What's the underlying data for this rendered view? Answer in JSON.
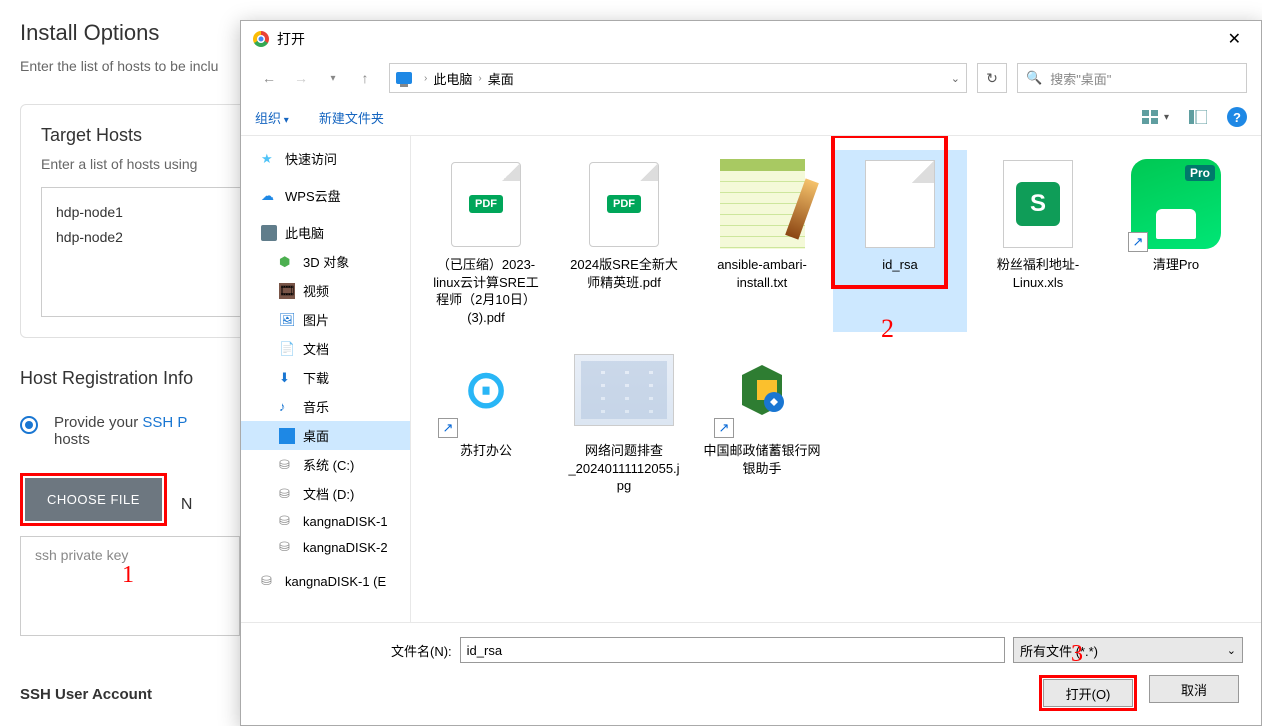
{
  "bg": {
    "title": "Install Options",
    "subtitle": "Enter the list of hosts to be inclu",
    "targetHosts": {
      "heading": "Target Hosts",
      "desc": "Enter a list of hosts using",
      "line1": "hdp-node1",
      "line2": "hdp-node2"
    },
    "reg": {
      "heading": "Host Registration Info",
      "radioLabel_pre": "Provide your ",
      "radioLabel_link": "SSH P",
      "radioLabel_post": "hosts",
      "chooseFile": "CHOOSE FILE",
      "letterN": "N",
      "keyPlaceholder": "ssh private key",
      "sshAccount": "SSH User Account"
    },
    "annotation1": "1"
  },
  "dialog": {
    "title": "打开",
    "path": {
      "seg1": "此电脑",
      "seg2": "桌面"
    },
    "searchPlaceholder": "搜索\"桌面\"",
    "toolbar": {
      "organize": "组织",
      "newFolder": "新建文件夹"
    },
    "sidebar": {
      "quickAccess": "快速访问",
      "wps": "WPS云盘",
      "thisPc": "此电脑",
      "d3": "3D 对象",
      "video": "视频",
      "pictures": "图片",
      "docs": "文档",
      "downloads": "下载",
      "music": "音乐",
      "desktop": "桌面",
      "sysC": "系统 (C:)",
      "docD": "文档 (D:)",
      "kd1": "kangnaDISK-1",
      "kd2": "kangnaDISK-2",
      "kd1e": "kangnaDISK-1 (E"
    },
    "files": {
      "f1": "（已压缩）2023-linux云计算SRE工程师（2月10日）(3).pdf",
      "f2": "2024版SRE全新大师精英班.pdf",
      "f3": "ansible-ambari-install.txt",
      "f4": "id_rsa",
      "f5": "粉丝福利地址-Linux.xls",
      "f6": "清理Pro",
      "f7": "苏打办公",
      "f8": "网络问题排查_20240111112055.jpg",
      "f9": "中国邮政储蓄银行网银助手",
      "pdfBadge": "PDF"
    },
    "footer": {
      "fnLabel": "文件名(N):",
      "fnValue": "id_rsa",
      "filter": "所有文件 (*.*)",
      "open": "打开(O)",
      "cancel": "取消"
    },
    "annotation2": "2",
    "annotation3": "3"
  }
}
